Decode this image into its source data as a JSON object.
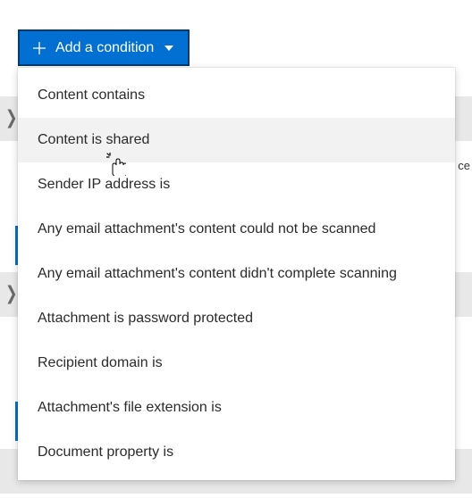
{
  "button": {
    "label": "Add a condition"
  },
  "menu": {
    "items": [
      {
        "label": "Content contains"
      },
      {
        "label": "Content is shared"
      },
      {
        "label": "Sender IP address is"
      },
      {
        "label": "Any email attachment's content could not be scanned"
      },
      {
        "label": "Any email attachment's content didn't complete scanning"
      },
      {
        "label": "Attachment is password protected"
      },
      {
        "label": "Recipient domain is"
      },
      {
        "label": "Attachment's file extension is"
      },
      {
        "label": "Document property is"
      }
    ],
    "hovered_index": 1
  },
  "background": {
    "edge_text_fragment": "ce"
  }
}
